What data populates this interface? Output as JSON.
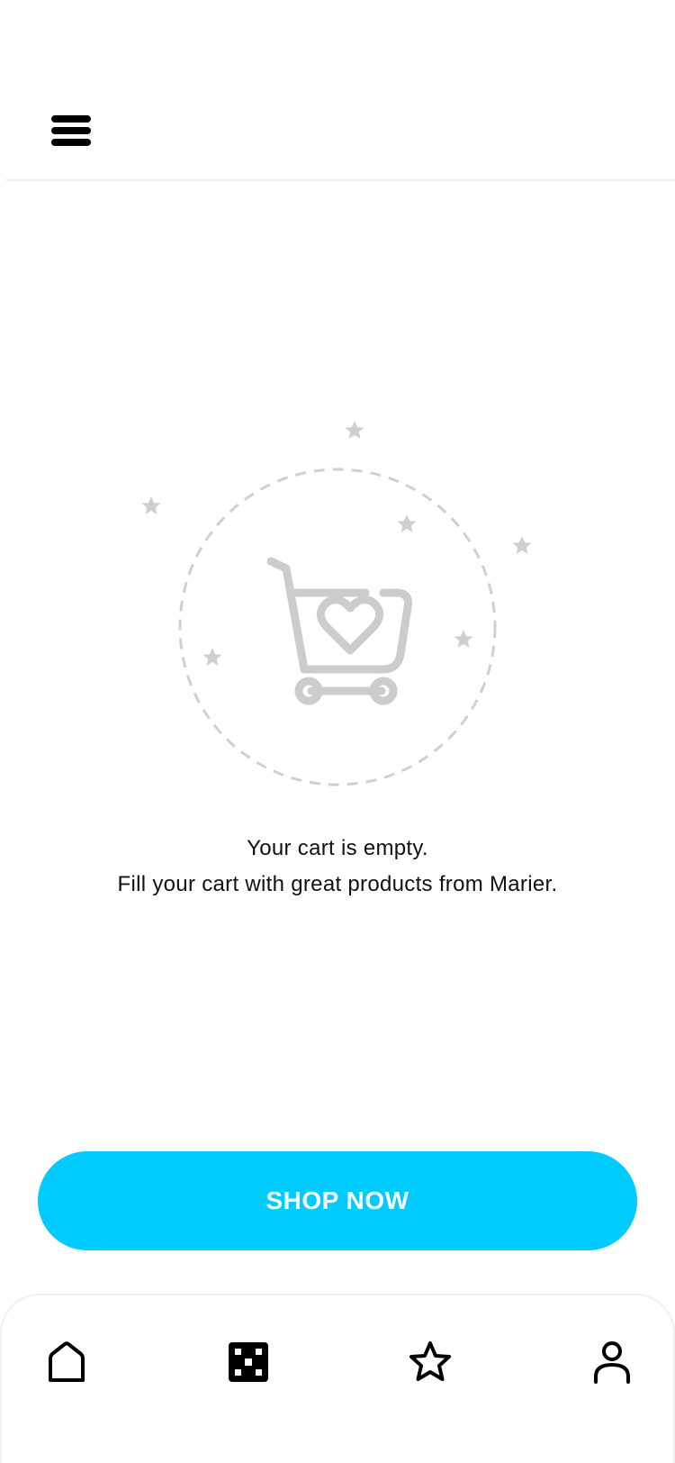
{
  "header": {
    "menu_icon": "menu-icon"
  },
  "empty_state": {
    "illustration_icon": "shopping-cart-heart-icon",
    "line1": "Your cart is empty.",
    "line2": "Fill your cart with great products from Marier."
  },
  "cta": {
    "label": "SHOP NOW",
    "color": "#00cbff"
  },
  "bottom_nav": {
    "items": [
      {
        "icon": "home-icon"
      },
      {
        "icon": "grid-icon"
      },
      {
        "icon": "star-icon"
      },
      {
        "icon": "user-icon"
      }
    ]
  }
}
